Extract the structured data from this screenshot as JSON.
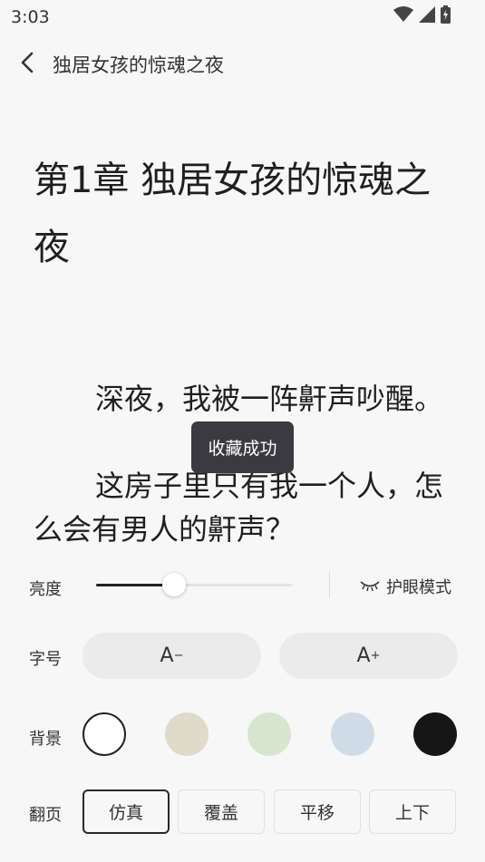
{
  "status_bar": {
    "time": "3:03",
    "icons": [
      "wifi-icon",
      "signal-icon",
      "battery-charging-icon"
    ]
  },
  "app_bar": {
    "title": "独居女孩的惊魂之夜",
    "back_icon": "chevron-left-icon"
  },
  "reader": {
    "chapter_title": "第1章 独居女孩的惊魂之夜",
    "paragraphs": [
      "深夜，我被一阵鼾声吵醒。",
      "这房子里只有我一个人，怎么会有男人的鼾声？"
    ]
  },
  "toast": {
    "text": "收藏成功"
  },
  "settings": {
    "brightness": {
      "label": "亮度",
      "value": 0.4
    },
    "eye_mode": {
      "label": "护眼模式",
      "icon": "closed-eye-icon"
    },
    "font_size": {
      "label": "字号",
      "decrease": "A",
      "decrease_sup": "−",
      "increase": "A",
      "increase_sup": "+"
    },
    "background": {
      "label": "背景",
      "options": [
        {
          "color": "#ffffff",
          "selected": true
        },
        {
          "color": "#e0dbc8",
          "selected": false
        },
        {
          "color": "#d6e6cf",
          "selected": false
        },
        {
          "color": "#cfdbe6",
          "selected": false
        },
        {
          "color": "#161616",
          "selected": false
        }
      ]
    },
    "page_turn": {
      "label": "翻页",
      "options": [
        "仿真",
        "覆盖",
        "平移",
        "上下"
      ],
      "selected_index": 0
    }
  }
}
